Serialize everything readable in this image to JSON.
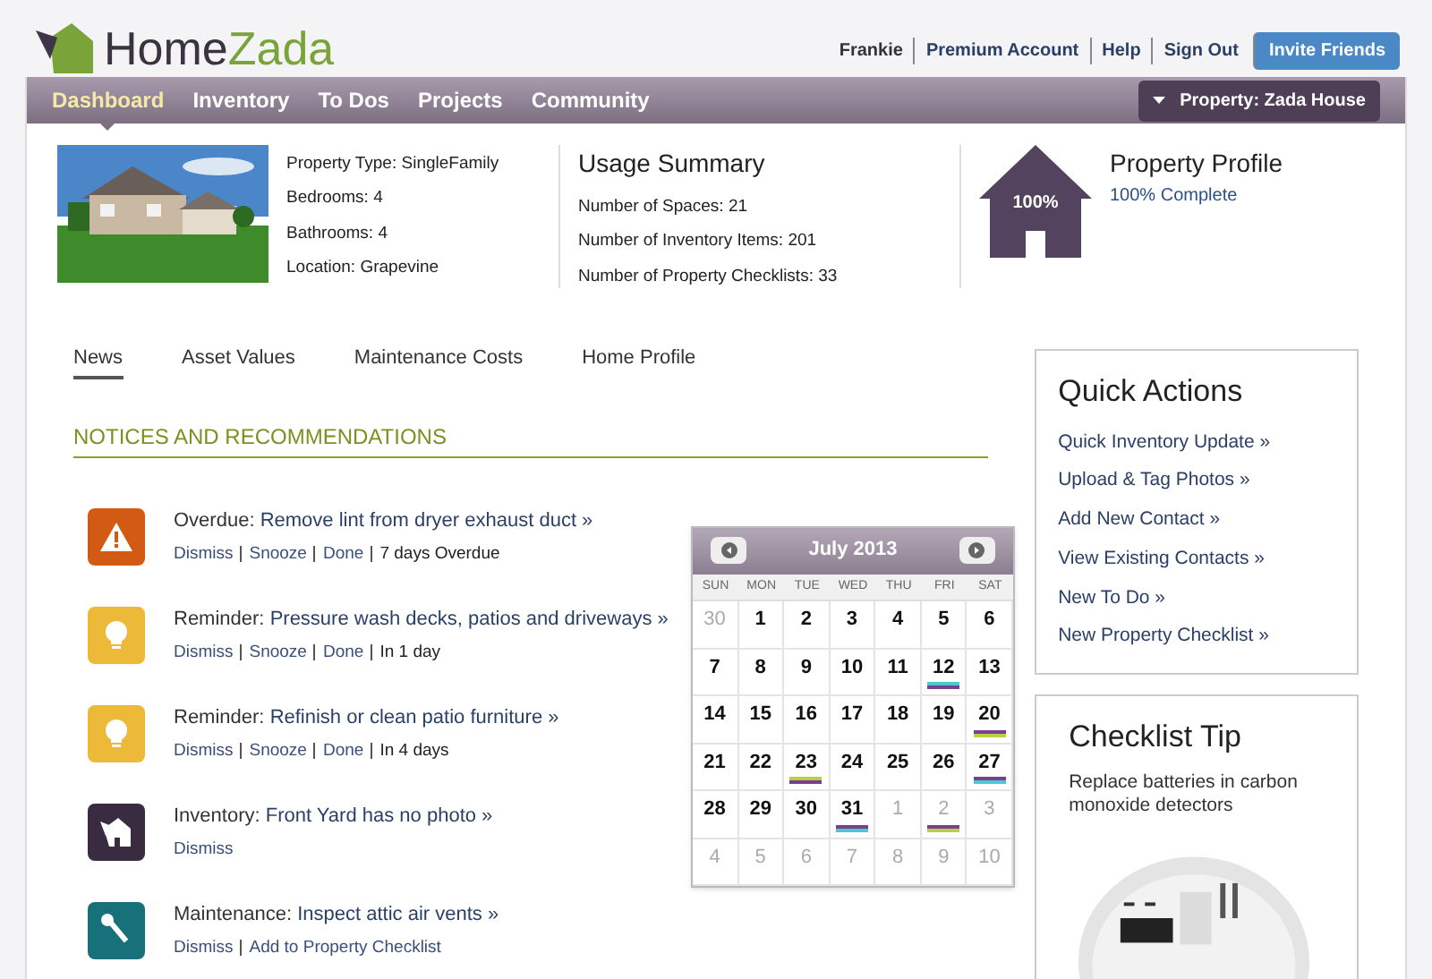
{
  "brand": {
    "name_part_1": "Home",
    "name_part_2": "Zada"
  },
  "user_links": [
    "Frankie",
    "Premium Account",
    "Help",
    "Sign Out"
  ],
  "invite_button": "Invite Friends",
  "nav": [
    {
      "label": "Dashboard",
      "selected": true
    },
    {
      "label": "Inventory",
      "selected": false
    },
    {
      "label": "To Dos",
      "selected": false
    },
    {
      "label": "Projects",
      "selected": false
    },
    {
      "label": "Community",
      "selected": false
    }
  ],
  "property_button": "Property: Zada House",
  "property": {
    "details": [
      "Property Type: SingleFamily",
      "Bedrooms: 4",
      "Bathrooms: 4",
      "Location: Grapevine"
    ]
  },
  "usage_summary": {
    "title": "Usage Summary",
    "lines": [
      "Number of Spaces: 21",
      "Number of Inventory Items: 201",
      "Number of Property Checklists: 33"
    ]
  },
  "profile": {
    "badge": "100%",
    "title": "Property Profile",
    "subtitle": "100% Complete"
  },
  "tabs": [
    {
      "label": "News",
      "selected": true
    },
    {
      "label": "Asset Values",
      "selected": false
    },
    {
      "label": "Maintenance Costs",
      "selected": false
    },
    {
      "label": "Home Profile",
      "selected": false
    }
  ],
  "section_title": "NOTICES AND RECOMMENDATIONS",
  "notices": [
    {
      "kind": "overdue",
      "label": "Overdue:",
      "link": "Remove lint from dryer exhaust duct »",
      "actions": [
        "Dismiss",
        "Snooze",
        "Done"
      ],
      "due": "7 days Overdue"
    },
    {
      "kind": "reminder",
      "label": "Reminder:",
      "link": "Pressure wash decks, patios and driveways »",
      "actions": [
        "Dismiss",
        "Snooze",
        "Done"
      ],
      "due": "In 1 day"
    },
    {
      "kind": "reminder",
      "label": "Reminder:",
      "link": "Refinish or clean patio furniture »",
      "actions": [
        "Dismiss",
        "Snooze",
        "Done"
      ],
      "due": "In 4 days"
    },
    {
      "kind": "inventory",
      "label": "Inventory:",
      "link": "Front Yard has no photo »",
      "actions": [
        "Dismiss"
      ]
    },
    {
      "kind": "maintenance",
      "label": "Maintenance:",
      "link": "Inspect attic air vents  »",
      "actions": [
        "Dismiss",
        "Add to Property Checklist"
      ]
    }
  ],
  "calendar": {
    "title": "July 2013",
    "weekdays": [
      "SUN",
      "MON",
      "TUE",
      "WED",
      "THU",
      "FRI",
      "SAT"
    ],
    "days": [
      {
        "label": "30",
        "muted": true
      },
      {
        "label": "1",
        "muted": false
      },
      {
        "label": "2",
        "muted": false
      },
      {
        "label": "3",
        "muted": false
      },
      {
        "label": "4",
        "muted": false
      },
      {
        "label": "5",
        "muted": false
      },
      {
        "label": "6",
        "muted": false
      },
      {
        "label": "7",
        "muted": false
      },
      {
        "label": "8",
        "muted": false
      },
      {
        "label": "9",
        "muted": false
      },
      {
        "label": "10",
        "muted": false
      },
      {
        "label": "11",
        "muted": false
      },
      {
        "label": "12",
        "muted": false,
        "events": [
          {
            "color": "#4cc8d0"
          },
          {
            "color": "#7a3f8f"
          }
        ]
      },
      {
        "label": "13",
        "muted": false
      },
      {
        "label": "14",
        "muted": false
      },
      {
        "label": "15",
        "muted": false
      },
      {
        "label": "16",
        "muted": false
      },
      {
        "label": "17",
        "muted": false
      },
      {
        "label": "18",
        "muted": false
      },
      {
        "label": "19",
        "muted": false
      },
      {
        "label": "20",
        "muted": false,
        "events": [
          {
            "color": "#7a3f8f"
          },
          {
            "color": "#b8d040"
          }
        ]
      },
      {
        "label": "21",
        "muted": false
      },
      {
        "label": "22",
        "muted": false
      },
      {
        "label": "23",
        "muted": false,
        "events": [
          {
            "color": "#b8d040"
          },
          {
            "color": "#7a3f8f"
          }
        ]
      },
      {
        "label": "24",
        "muted": false
      },
      {
        "label": "25",
        "muted": false
      },
      {
        "label": "26",
        "muted": false
      },
      {
        "label": "27",
        "muted": false,
        "events": [
          {
            "color": "#7a3f8f"
          },
          {
            "color": "#4cc8d0"
          }
        ]
      },
      {
        "label": "28",
        "muted": false
      },
      {
        "label": "29",
        "muted": false
      },
      {
        "label": "30",
        "muted": false
      },
      {
        "label": "31",
        "muted": false,
        "events": [
          {
            "color": "#7a3f8f"
          },
          {
            "color": "#4cc8d0"
          }
        ]
      },
      {
        "label": "1",
        "muted": true
      },
      {
        "label": "2",
        "muted": true,
        "events": [
          {
            "color": "#7a3f8f"
          },
          {
            "color": "#b8d040"
          }
        ]
      },
      {
        "label": "3",
        "muted": true
      },
      {
        "label": "4",
        "muted": true
      },
      {
        "label": "5",
        "muted": true
      },
      {
        "label": "6",
        "muted": true
      },
      {
        "label": "7",
        "muted": true
      },
      {
        "label": "8",
        "muted": true
      },
      {
        "label": "9",
        "muted": true
      },
      {
        "label": "10",
        "muted": true
      }
    ]
  },
  "quick_actions": {
    "title": "Quick Actions",
    "links": [
      "Quick Inventory Update »",
      "Upload & Tag Photos »",
      "Add New Contact »",
      "View Existing Contacts »",
      "New To Do »",
      "New Property Checklist »"
    ]
  },
  "checklist_tip": {
    "title": "Checklist Tip",
    "text": "Replace batteries in carbon monoxide detectors"
  }
}
